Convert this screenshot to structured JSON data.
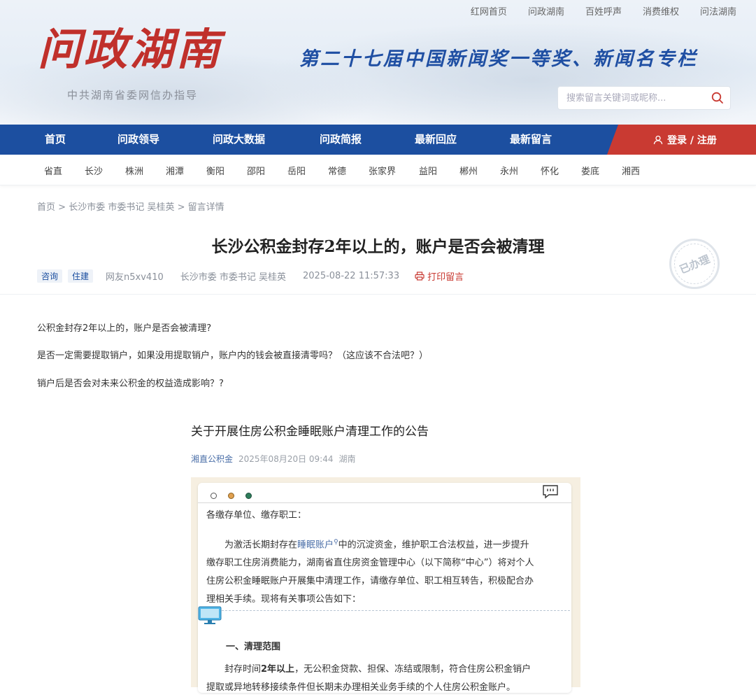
{
  "top_links": [
    "红网首页",
    "问政湖南",
    "百姓呼声",
    "消费维权",
    "问法湖南"
  ],
  "logo": {
    "text": "问政湖南",
    "sub": "中共湖南省委网信办指导"
  },
  "slogan": "第二十七届中国新闻奖一等奖、新闻名专栏",
  "search": {
    "placeholder": "搜索留言关键词或昵称..."
  },
  "nav": [
    "首页",
    "问政领导",
    "问政大数据",
    "问政简报",
    "最新回应",
    "最新留言"
  ],
  "login": "登录 / 注册",
  "cities": [
    "省直",
    "长沙",
    "株洲",
    "湘潭",
    "衡阳",
    "邵阳",
    "岳阳",
    "常德",
    "张家界",
    "益阳",
    "郴州",
    "永州",
    "怀化",
    "娄底",
    "湘西"
  ],
  "breadcrumb": {
    "home": "首页",
    "sep1": " > ",
    "section": "长沙市委 市委书记 吴桂英",
    "sep2": " > ",
    "current": "留言详情"
  },
  "post": {
    "title": "长沙公积金封存2年以上的，账户是否会被清理",
    "tags": [
      "咨询",
      "住建"
    ],
    "user": "网友n5xv410",
    "target": "长沙市委 市委书记 吴桂英",
    "time": "2025-08-22 11:57:33",
    "print": "打印留言",
    "stamp": "已办理",
    "paragraphs": [
      "公积金封存2年以上的，账户是否会被清理?",
      "是否一定需要提取销户，如果没用提取销户，账户内的钱会被直接清零吗？（这应该不合法吧？）",
      "销户后是否会对未来公积金的权益造成影响？?"
    ]
  },
  "article": {
    "title": "关于开展住房公积金睡眠账户清理工作的公告",
    "source": "湘直公积金",
    "date": "2025年08月20日 09:44",
    "region": "湖南"
  },
  "notice": {
    "salutation": "各缴存单位、缴存职工：",
    "p1_a": "为激活长期封存在",
    "p1_link": "睡眠账户",
    "p1_b": "中的沉淀资金，维护职工合法权益，进一步提升",
    "p1_l2": "缴存职工住房消费能力，湖南省直住房资金管理中心（以下简称“中心”）将对个人",
    "p1_l3": "住房公积金睡眠账户开展集中清理工作，请缴存单位、职工相互转告，积极配合办",
    "p1_l4": "理相关手续。现将有关事项公告如下：",
    "section1": "一、清理范围",
    "p2_a": "封存时间",
    "p2_bold": "2年以上",
    "p2_b": "，无公积金贷款、担保、冻结或限制，符合住房公积金销户",
    "p2_l2": "提取或异地转移接续条件但长期未办理相关业务手续的个人住房公积金账户。"
  },
  "colors": {
    "nav": "#1c4fa0",
    "accent": "#c93a32",
    "dot1": "#ffffff",
    "dot2": "#e0a050",
    "dot3": "#2e7d5b"
  }
}
